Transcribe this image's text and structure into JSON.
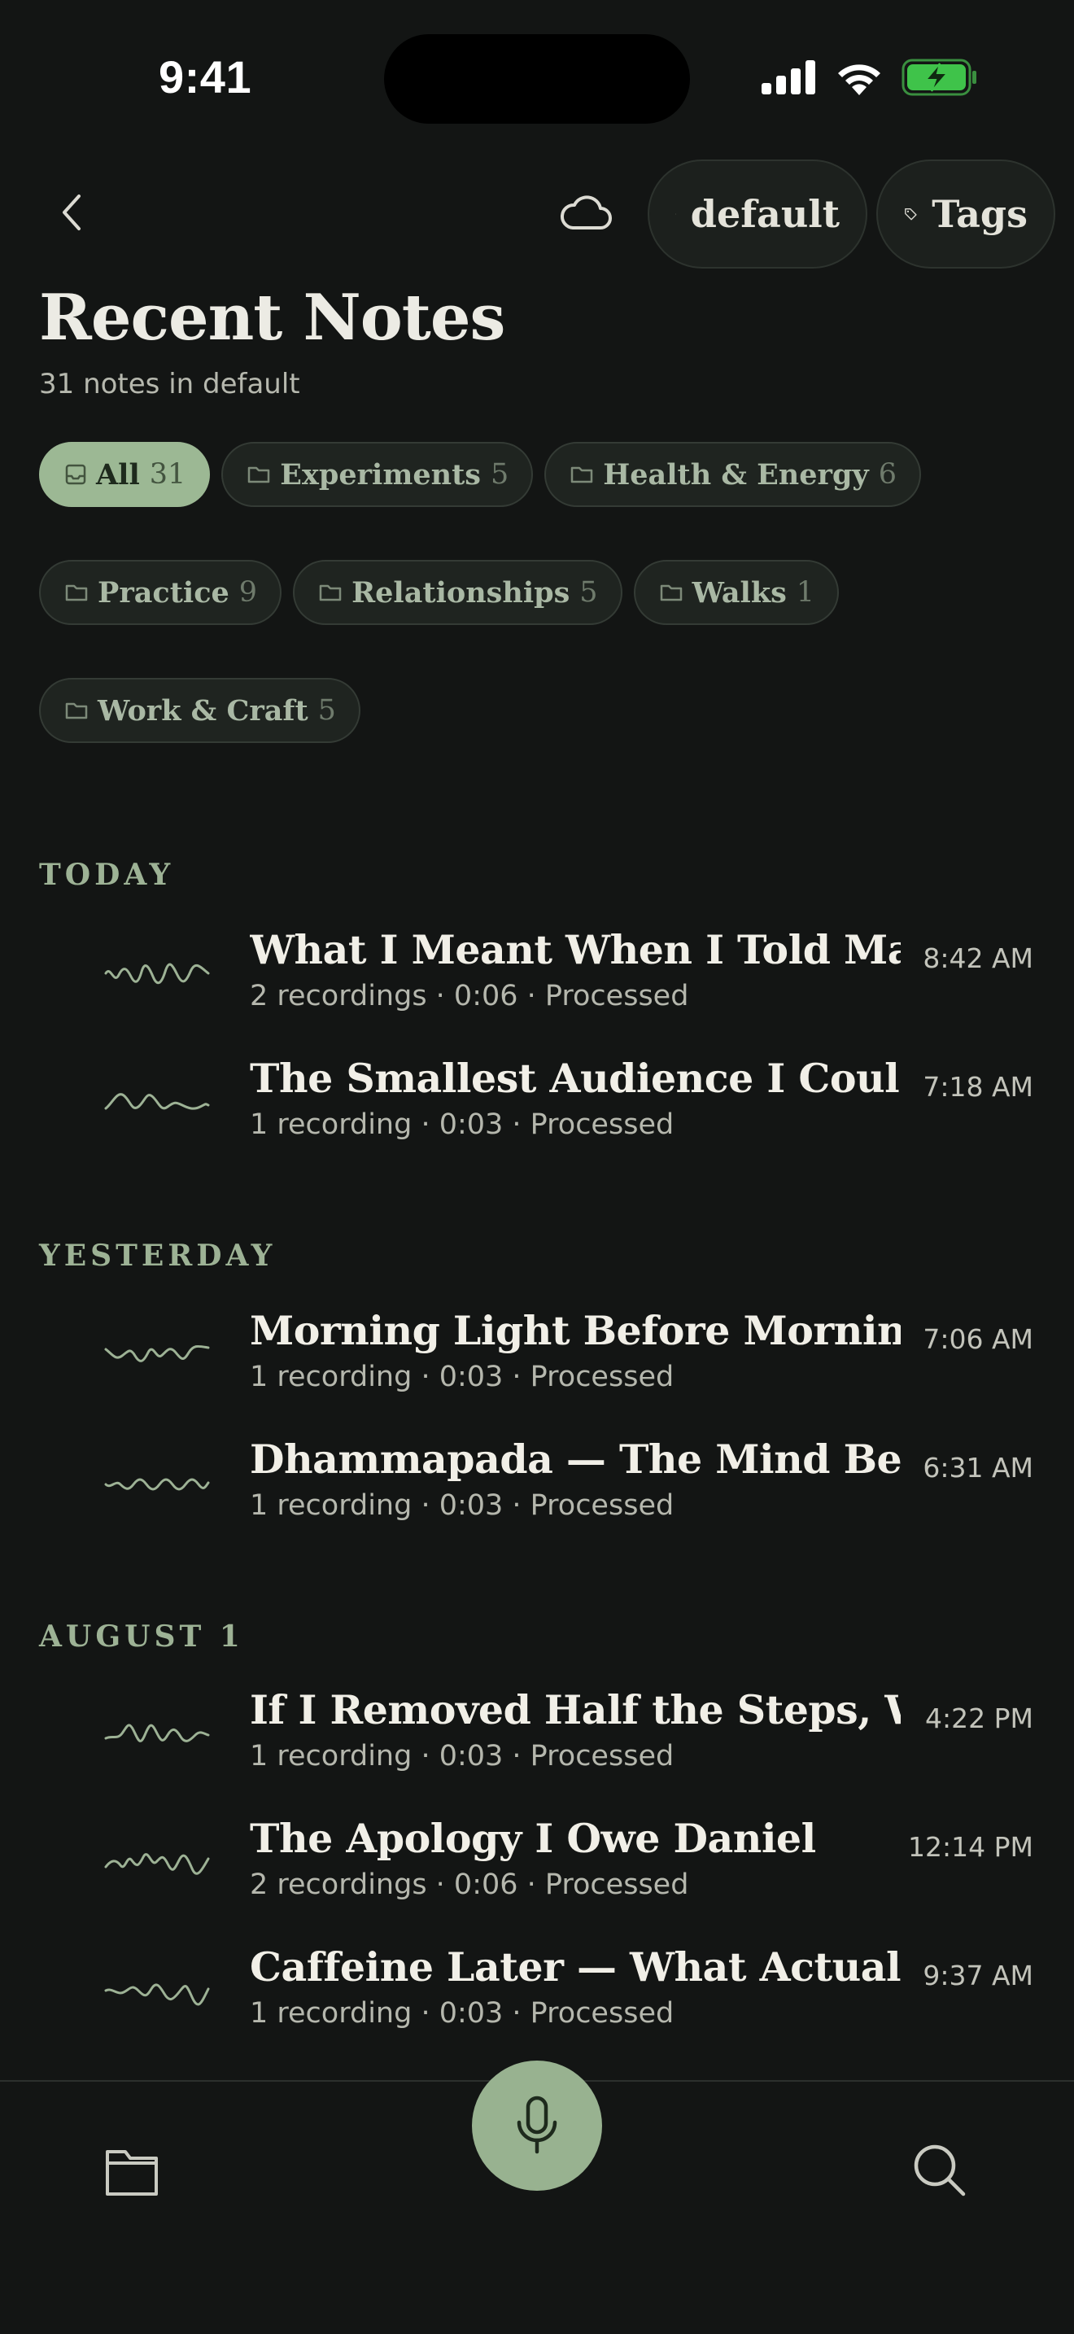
{
  "status": {
    "time": "9:41"
  },
  "nav": {
    "back_icon": "chevron-left-icon",
    "cloud_icon": "cloud-icon",
    "notebook_label": "default",
    "tags_label": "Tags"
  },
  "header": {
    "title": "Recent Notes",
    "subtitle": "31 notes in default"
  },
  "chips": [
    {
      "label": "All",
      "count": "31",
      "active": true
    },
    {
      "label": "Experiments",
      "count": "5"
    },
    {
      "label": "Health & Energy",
      "count": "6"
    },
    {
      "label": "Practice",
      "count": "9"
    },
    {
      "label": "Relationships",
      "count": "5"
    },
    {
      "label": "Walks",
      "count": "1"
    },
    {
      "label": "Work & Craft",
      "count": "5"
    }
  ],
  "sections": [
    {
      "label": "TODAY",
      "notes": [
        {
          "title": "What I Meant When I Told Ma...",
          "meta": "2 recordings · 0:06 · Processed",
          "time": "8:42 AM"
        },
        {
          "title": "The Smallest Audience I Coul...",
          "meta": "1 recording · 0:03 · Processed",
          "time": "7:18 AM"
        }
      ]
    },
    {
      "label": "YESTERDAY",
      "notes": [
        {
          "title": "Morning Light Before Mornin...",
          "meta": "1 recording · 0:03 · Processed",
          "time": "7:06 AM"
        },
        {
          "title": "Dhammapada — The Mind Bef...",
          "meta": "1 recording · 0:03 · Processed",
          "time": "6:31 AM"
        }
      ]
    },
    {
      "label": "AUGUST 1",
      "notes": [
        {
          "title": "If I Removed Half the Steps, W...",
          "meta": "1 recording · 0:03 · Processed",
          "time": "4:22 PM"
        },
        {
          "title": "The Apology I Owe Daniel",
          "meta": "2 recordings · 0:06 · Processed",
          "time": "12:14 PM"
        },
        {
          "title": "Caffeine Later — What Actuall...",
          "meta": "1 recording · 0:03 · Processed",
          "time": "9:37 AM"
        }
      ]
    }
  ],
  "tabbar": {
    "left_icon": "folder-icon",
    "center_icon": "microphone-icon",
    "right_icon": "search-icon"
  },
  "colors": {
    "background": "#131514",
    "accent": "#9cb894",
    "text": "#ecebe4"
  }
}
